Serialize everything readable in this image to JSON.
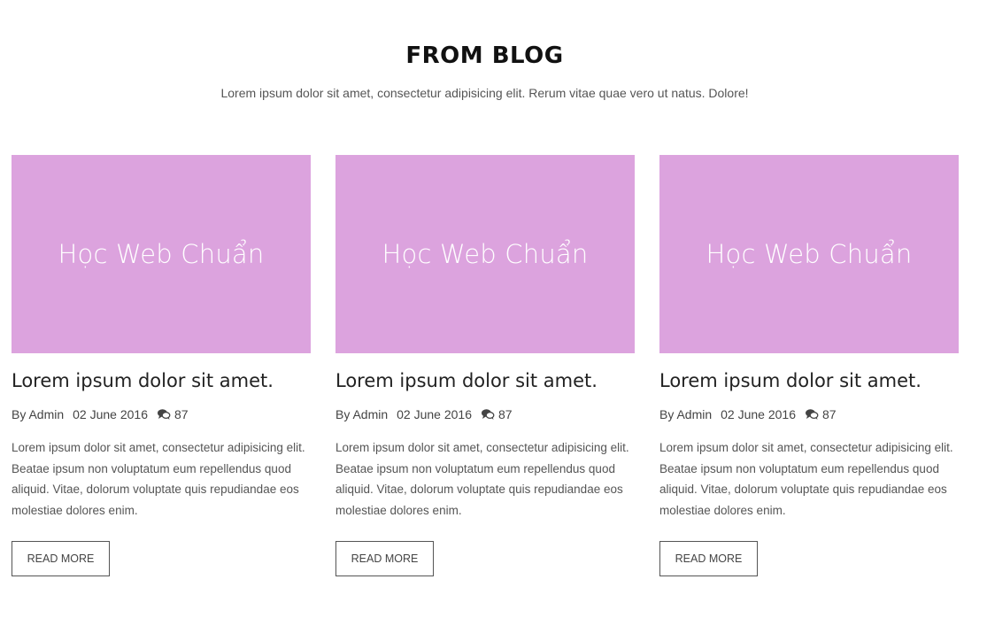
{
  "section": {
    "title": "FROM BLOG",
    "subtitle": "Lorem ipsum dolor sit amet, consectetur adipisicing elit. Rerum vitae quae vero ut natus. Dolore!"
  },
  "colors": {
    "thumbnail_bg": "#dca3de"
  },
  "posts": [
    {
      "thumbnail_text": "Học Web Chuẩn",
      "title": "Lorem ipsum dolor sit amet.",
      "author": "By Admin",
      "date": "02 June 2016",
      "comments": "87",
      "comment_icon": "comment-bubbles-icon",
      "excerpt": "Lorem ipsum dolor sit amet, consectetur adipisicing elit. Beatae ipsum non voluptatum eum repellendus quod aliquid. Vitae, dolorum voluptate quis repudiandae eos molestiae dolores enim.",
      "read_more": "READ MORE"
    },
    {
      "thumbnail_text": "Học Web Chuẩn",
      "title": "Lorem ipsum dolor sit amet.",
      "author": "By Admin",
      "date": "02 June 2016",
      "comments": "87",
      "comment_icon": "comment-bubbles-icon",
      "excerpt": "Lorem ipsum dolor sit amet, consectetur adipisicing elit. Beatae ipsum non voluptatum eum repellendus quod aliquid. Vitae, dolorum voluptate quis repudiandae eos molestiae dolores enim.",
      "read_more": "READ MORE"
    },
    {
      "thumbnail_text": "Học Web Chuẩn",
      "title": "Lorem ipsum dolor sit amet.",
      "author": "By Admin",
      "date": "02 June 2016",
      "comments": "87",
      "comment_icon": "comment-bubbles-icon",
      "excerpt": "Lorem ipsum dolor sit amet, consectetur adipisicing elit. Beatae ipsum non voluptatum eum repellendus quod aliquid. Vitae, dolorum voluptate quis repudiandae eos molestiae dolores enim.",
      "read_more": "READ MORE"
    }
  ]
}
